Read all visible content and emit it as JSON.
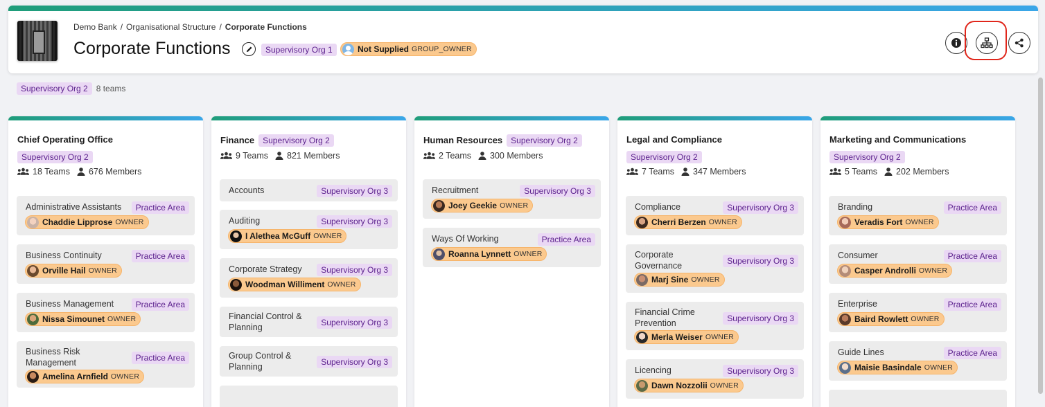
{
  "breadcrumb": [
    "Demo Bank",
    "Organisational Structure",
    "Corporate Functions"
  ],
  "title": "Corporate Functions",
  "header_tag": "Supervisory Org 1",
  "header_owner": {
    "name": "Not Supplied",
    "role": "GROUP_OWNER"
  },
  "sub_tag": "Supervisory Org 2",
  "teams_count": "8 teams",
  "columns": [
    {
      "title": "Chief Operating Office",
      "tag": "Supervisory Org 2",
      "teams": "18 Teams",
      "members": "676 Members",
      "items": [
        {
          "name": "Administrative Assistants",
          "tag": "Practice Area",
          "owner": "Chaddie Lipprose",
          "role": "OWNER"
        },
        {
          "name": "Business Continuity",
          "tag": "Practice Area",
          "owner": "Orville Hail",
          "role": "OWNER"
        },
        {
          "name": "Business Management",
          "tag": "Practice Area",
          "owner": "Nissa Simounet",
          "role": "OWNER"
        },
        {
          "name": "Business Risk Management",
          "tag": "Practice Area",
          "owner": "Amelina Arnfield",
          "role": "OWNER"
        }
      ]
    },
    {
      "title": "Finance",
      "tag": "Supervisory Org 2",
      "teams": "9 Teams",
      "members": "821 Members",
      "items": [
        {
          "name": "Accounts",
          "tag": "Supervisory Org 3"
        },
        {
          "name": "Auditing",
          "tag": "Supervisory Org 3",
          "owner": "I Alethea McGuff",
          "role": "OWNER"
        },
        {
          "name": "Corporate Strategy",
          "tag": "Supervisory Org 3",
          "owner": "Woodman Williment",
          "role": "OWNER"
        },
        {
          "name": "Financial Control & Planning",
          "tag": "Supervisory Org 3"
        },
        {
          "name": "Group Control & Planning",
          "tag": "Supervisory Org 3"
        }
      ]
    },
    {
      "title": "Human Resources",
      "tag": "Supervisory Org 2",
      "teams": "2 Teams",
      "members": "300 Members",
      "items": [
        {
          "name": "Recruitment",
          "tag": "Supervisory Org 3",
          "owner": "Joey Geekie",
          "role": "OWNER"
        },
        {
          "name": "Ways Of Working",
          "tag": "Practice Area",
          "owner": "Roanna Lynnett",
          "role": "OWNER"
        }
      ]
    },
    {
      "title": "Legal and Compliance",
      "tag": "Supervisory Org 2",
      "teams": "7 Teams",
      "members": "347 Members",
      "items": [
        {
          "name": "Compliance",
          "tag": "Supervisory Org 3",
          "owner": "Cherri Berzen",
          "role": "OWNER"
        },
        {
          "name": "Corporate Governance",
          "tag": "Supervisory Org 3",
          "owner": "Marj Sine",
          "role": "OWNER"
        },
        {
          "name": "Financial Crime Prevention",
          "tag": "Supervisory Org 3",
          "owner": "Merla Weiser",
          "role": "OWNER"
        },
        {
          "name": "Licencing",
          "tag": "Supervisory Org 3",
          "owner": "Dawn Nozzolii",
          "role": "OWNER"
        }
      ]
    },
    {
      "title": "Marketing and Communications",
      "tag": "Supervisory Org 2",
      "teams": "5 Teams",
      "members": "202 Members",
      "items": [
        {
          "name": "Branding",
          "tag": "Practice Area",
          "owner": "Veradis Fort",
          "role": "OWNER"
        },
        {
          "name": "Consumer",
          "tag": "Practice Area",
          "owner": "Casper Androlli",
          "role": "OWNER"
        },
        {
          "name": "Enterprise",
          "tag": "Practice Area",
          "owner": "Baird Rowlett",
          "role": "OWNER"
        },
        {
          "name": "Guide Lines",
          "tag": "Practice Area",
          "owner": "Maisie Basindale",
          "role": "OWNER"
        }
      ]
    }
  ]
}
